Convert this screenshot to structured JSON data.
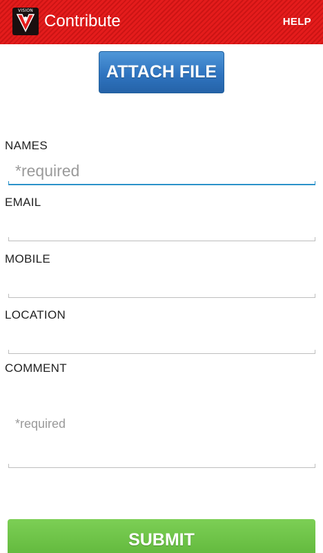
{
  "action_bar": {
    "title": "Contribute",
    "help_label": "HELP",
    "logo_text": "VISION",
    "logo_icon": "v-vision-logo",
    "color": "#e41c1c"
  },
  "attach_button": {
    "label": "ATTACH FILE",
    "color": "#2f74c0"
  },
  "form": {
    "names": {
      "label": "NAMES",
      "placeholder": "*required",
      "value": ""
    },
    "email": {
      "label": "EMAIL",
      "value": ""
    },
    "mobile": {
      "label": "MOBILE",
      "value": ""
    },
    "location": {
      "label": "LOCATION",
      "value": ""
    },
    "comment": {
      "label": "COMMENT",
      "placeholder": "*required",
      "value": ""
    },
    "focus_color": "#2b92c9"
  },
  "submit_button": {
    "label": "SUBMIT",
    "color": "#5fb63a"
  }
}
